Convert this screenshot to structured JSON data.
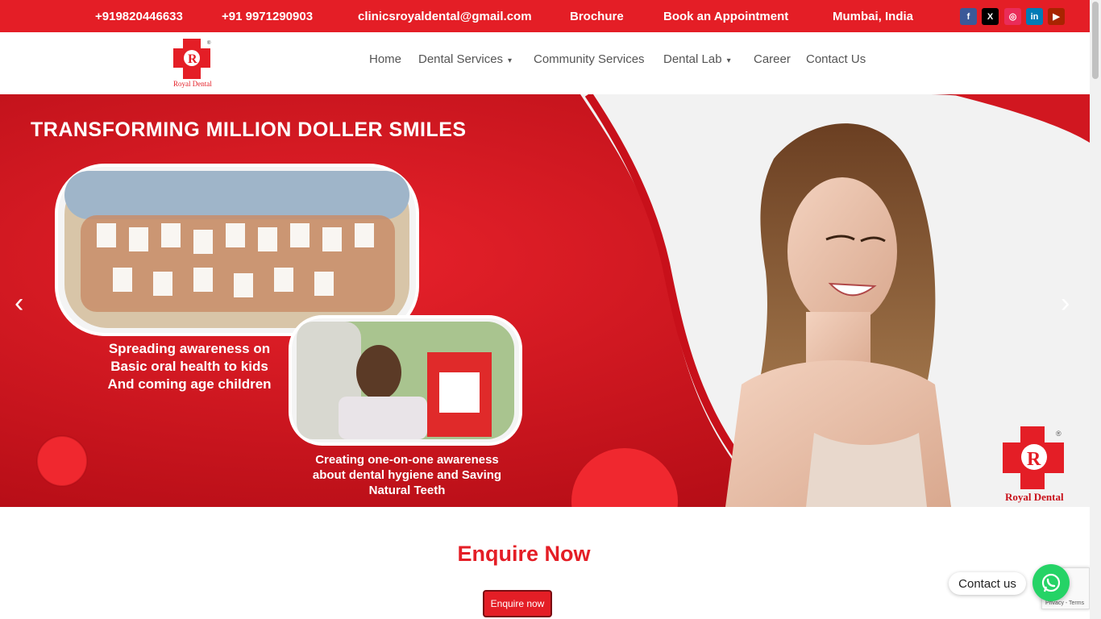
{
  "topbar": {
    "phone1": "+919820446633",
    "phone2": "+91 9971290903",
    "email": "clinicsroyaldental@gmail.com",
    "brochure": "Brochure",
    "appointment": "Book an Appointment",
    "location": "Mumbai, India",
    "socials": [
      {
        "name": "facebook-icon",
        "glyph": "f",
        "color": "#3b5998"
      },
      {
        "name": "x-twitter-icon",
        "glyph": "X",
        "color": "#000000"
      },
      {
        "name": "instagram-icon",
        "glyph": "◎",
        "color": "#ea2c59"
      },
      {
        "name": "linkedin-icon",
        "glyph": "in",
        "color": "#007bb6"
      },
      {
        "name": "youtube-icon",
        "glyph": "▶",
        "color": "#a82400"
      }
    ]
  },
  "header": {
    "logo_text": "Royal Dental",
    "logo_letter": "R",
    "nav": {
      "home": "Home",
      "dental_services": "Dental Services",
      "community_services": "Community Services",
      "dental_lab": "Dental Lab",
      "career": "Career",
      "contact_us": "Contact Us"
    },
    "dropdown_icon": "▾"
  },
  "hero": {
    "title": "TRANSFORMING MILLION DOLLER SMILES",
    "caption1": [
      "Spreading awareness on",
      "Basic oral health to kids",
      "And coming age children"
    ],
    "caption2": [
      "Creating one-on-one awareness",
      "about dental hygiene and Saving",
      "Natural Teeth"
    ],
    "logo_text": "Royal Dental",
    "logo_letter": "R",
    "prev_arrow": "‹",
    "next_arrow": "›"
  },
  "enquire": {
    "title": "Enquire Now",
    "button": "Enquire now"
  },
  "floating": {
    "contact_label": "Contact us",
    "recaptcha_text": "Privacy - Terms"
  },
  "colors": {
    "brand_red": "#e41e26",
    "whatsapp_green": "#25d366"
  }
}
